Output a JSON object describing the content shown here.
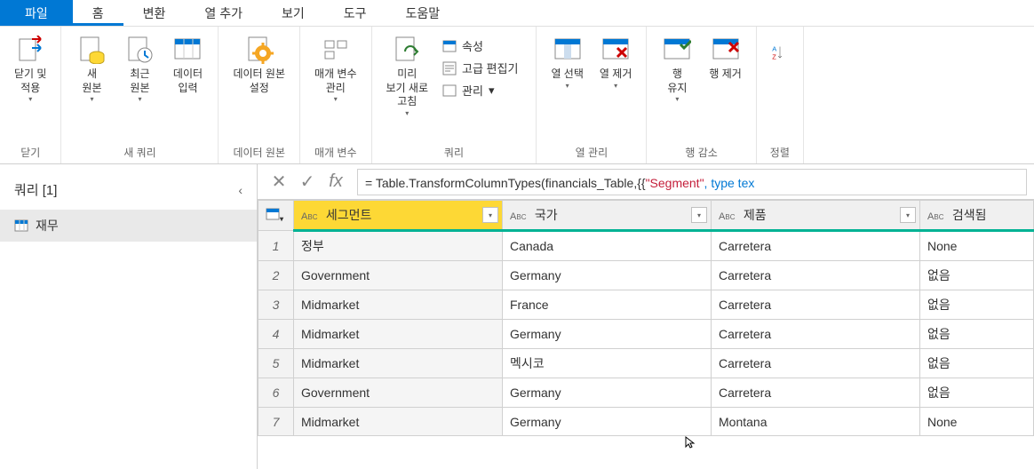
{
  "tabs": {
    "file": "파일",
    "home": "홈",
    "transform": "변환",
    "add_column": "열 추가",
    "view": "보기",
    "tools": "도구",
    "help": "도움말"
  },
  "ribbon": {
    "close": {
      "label": "닫기 및\n적용",
      "group": "닫기"
    },
    "new_query": {
      "new_source": "새\n원본",
      "recent": "최근\n원본",
      "enter_data": "데이터\n입력",
      "group": "새 쿼리"
    },
    "data_source": {
      "settings": "데이터 원본\n설정",
      "group": "데이터 원본"
    },
    "params": {
      "manage": "매개 변수\n관리",
      "group": "매개 변수"
    },
    "query": {
      "refresh": "미리\n보기 새로\n고침",
      "properties": "속성",
      "advanced": "고급 편집기",
      "manage": "관리",
      "group": "쿼리"
    },
    "cols": {
      "choose": "열 선택",
      "remove": "열 제거",
      "group": "열 관리"
    },
    "rows": {
      "keep": "행\n유지",
      "remove": "행 제거",
      "group": "행 감소"
    },
    "sort": {
      "group": "정렬"
    }
  },
  "sidebar": {
    "title": "쿼리 [1]",
    "item": "재무"
  },
  "formula": {
    "prefix": "= Table.TransformColumnTypes(financials_Table,{{",
    "segment": "\"Segment\"",
    "suffix": ", type tex"
  },
  "columns": [
    "세그먼트",
    "국가",
    "제품",
    "검색됨"
  ],
  "rows_data": [
    [
      "정부",
      "Canada",
      "Carretera",
      "None"
    ],
    [
      "Government",
      "Germany",
      "Carretera",
      "없음"
    ],
    [
      "Midmarket",
      "France",
      "Carretera",
      "없음"
    ],
    [
      "Midmarket",
      "Germany",
      "Carretera",
      "없음"
    ],
    [
      "Midmarket",
      "멕시코",
      "Carretera",
      "없음"
    ],
    [
      "Government",
      "Germany",
      "Carretera",
      "없음"
    ],
    [
      "Midmarket",
      "Germany",
      "Montana",
      "None"
    ]
  ]
}
